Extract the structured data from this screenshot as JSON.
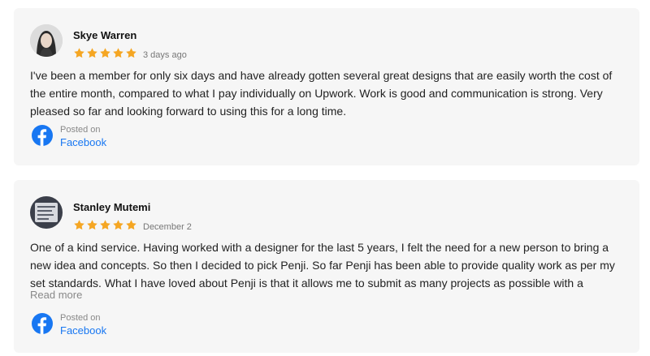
{
  "reviews": [
    {
      "name": "Skye Warren",
      "rating": 5,
      "rating_max": 5,
      "date": "3 days ago",
      "text": "I've been a member for only six days and have already gotten several great designs that are easily worth the cost of the entire month, compared to what I pay individually on Upwork. Work is good and communication is strong. Very pleased so far and looking forward to using this for a long time.",
      "posted_label": "Posted on",
      "posted_source": "Facebook"
    },
    {
      "name": "Stanley Mutemi",
      "rating": 5,
      "rating_max": 5,
      "date": "December 2",
      "text": "One of a kind service. Having worked with a designer for the last 5 years, I felt the need for a new person to bring a new idea and concepts. So then I decided to pick Penji. So far Penji has been able to provide quality work as per my set standards. What I have loved about Penji is that it allows me to submit as many projects as possible with a",
      "read_more": "Read more",
      "posted_label": "Posted on",
      "posted_source": "Facebook"
    }
  ],
  "colors": {
    "star": "#f5a623",
    "facebook": "#1877f2",
    "card_background": "#f6f6f6"
  },
  "icons": {
    "star": "star-icon",
    "facebook": "facebook-icon"
  }
}
